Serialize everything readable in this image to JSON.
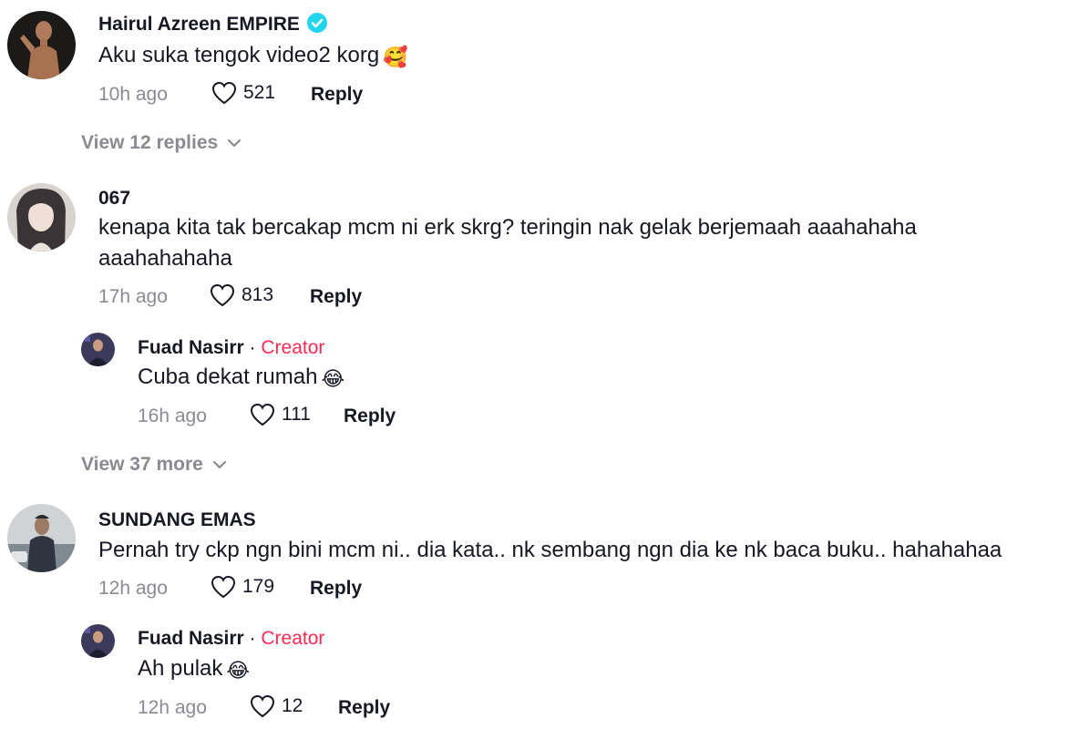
{
  "colors": {
    "text": "#161823",
    "muted": "#8a8b91",
    "creator": "#fe2c55",
    "verified": "#20d5ec"
  },
  "icons": {
    "verified": "verified-badge-icon",
    "like": "heart-outline-icon",
    "expand": "chevron-down-icon"
  },
  "comments": [
    {
      "username": "Hairul Azreen EMPIRE",
      "verified": true,
      "text": "Aku suka tengok video2 korg",
      "emoji": "🥰",
      "time": "10h ago",
      "likes": "521",
      "reply_label": "Reply",
      "view_more": "View 12 replies"
    },
    {
      "username": "067",
      "text_line1": "kenapa kita tak bercakap mcm ni erk skrg? teringin nak gelak berjemaah aaahahaha",
      "text_line2": "aaahahahaha",
      "time": "17h ago",
      "likes": "813",
      "reply_label": "Reply",
      "replies": [
        {
          "username": "Fuad Nasirr",
          "separator": " · ",
          "badge": "Creator",
          "text": "Cuba dekat rumah",
          "emoji": "😂",
          "time": "16h ago",
          "likes": "111",
          "reply_label": "Reply"
        }
      ],
      "view_more": "View 37 more"
    },
    {
      "username": "SUNDANG EMAS",
      "text": "Pernah try ckp ngn bini mcm ni.. dia kata.. nk sembang ngn dia ke nk baca buku.. hahahahaa",
      "time": "12h ago",
      "likes": "179",
      "reply_label": "Reply",
      "replies": [
        {
          "username": "Fuad Nasirr",
          "separator": " · ",
          "badge": "Creator",
          "text": "Ah pulak",
          "emoji": "😂",
          "time": "12h ago",
          "likes": "12",
          "reply_label": "Reply"
        }
      ]
    }
  ]
}
